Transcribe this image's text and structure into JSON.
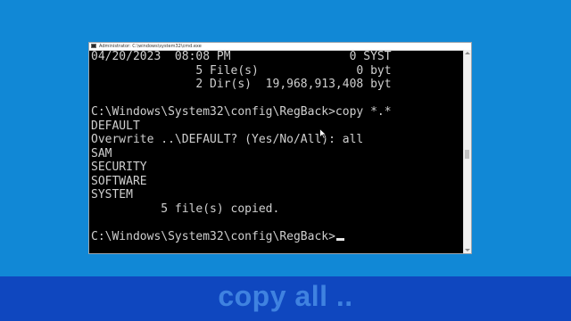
{
  "window": {
    "title": "Administrator: C:\\windows\\system32\\cmd.exe"
  },
  "console": {
    "lines": [
      "04/20/2023  08:08 PM                 0 SYST",
      "               5 File(s)              0 byt",
      "               2 Dir(s)  19,968,913,408 byt",
      "",
      "C:\\Windows\\System32\\config\\RegBack>copy *.*",
      "DEFAULT",
      "Overwrite ..\\DEFAULT? (Yes/No/All): all",
      "SAM",
      "SECURITY",
      "SOFTWARE",
      "SYSTEM",
      "          5 file(s) copied.",
      "",
      "C:\\Windows\\System32\\config\\RegBack>"
    ]
  },
  "caption": {
    "text": "copy all .."
  },
  "colors": {
    "desktop": "#1188d6",
    "caption_band": "#0f47bf",
    "caption_text": "#3f82e0",
    "console_bg": "#000000",
    "console_text": "#cfcfcf"
  },
  "icons": {
    "app": "cmd-icon",
    "pointer": "mouse-pointer-icon"
  }
}
